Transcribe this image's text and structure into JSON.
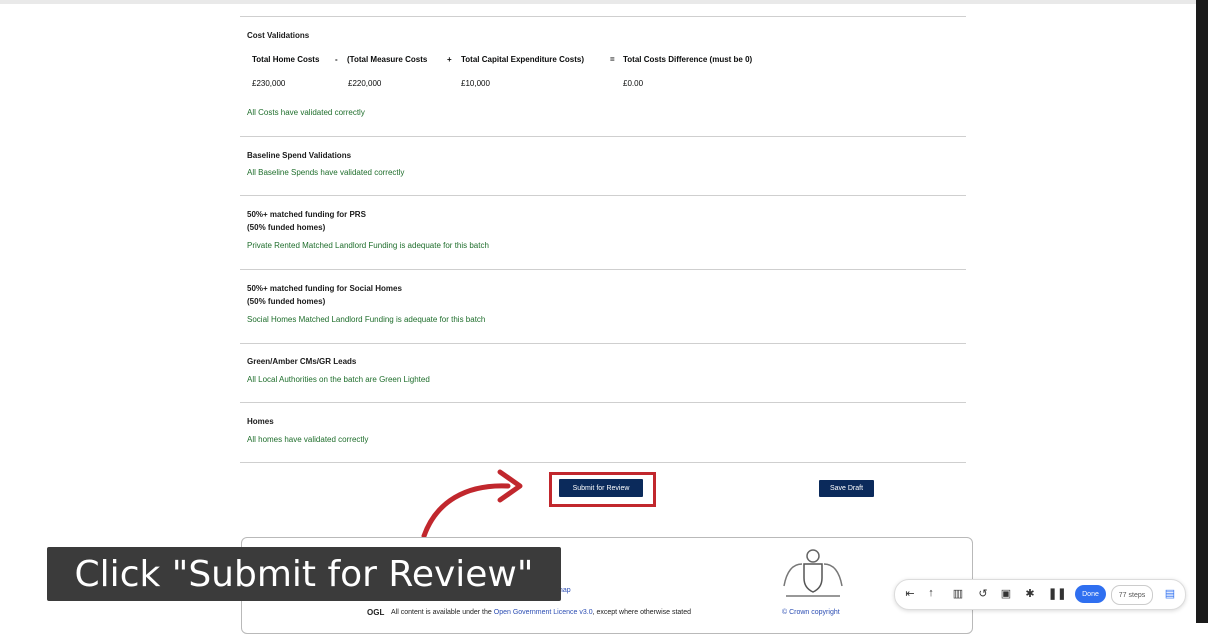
{
  "cost_validations": {
    "title": "Cost Validations",
    "headers": {
      "total_home": "Total Home Costs",
      "minus": "-",
      "measure": "(Total Measure Costs",
      "plus": "+",
      "capex": "Total Capital Expenditure Costs)",
      "equals": "=",
      "difference": "Total Costs Difference (must be 0)"
    },
    "values": {
      "total_home": "£230,000",
      "measure": "£220,000",
      "capex": "£10,000",
      "difference": "£0.00"
    },
    "status": "All Costs have validated correctly"
  },
  "baseline": {
    "title": "Baseline Spend Validations",
    "status": "All Baseline Spends have validated correctly"
  },
  "prs": {
    "title": "50%+ matched funding for PRS",
    "subtitle": "(50% funded homes)",
    "status": "Private Rented Matched Landlord Funding is adequate for this batch"
  },
  "social": {
    "title": "50%+ matched funding for Social Homes",
    "subtitle": "(50% funded homes)",
    "status": "Social Homes Matched Landlord Funding is adequate for this batch"
  },
  "green_amber": {
    "title": "Green/Amber CMs/GR Leads",
    "status": "All Local Authorities on the batch are Green Lighted"
  },
  "homes": {
    "title": "Homes",
    "status": "All homes have validated correctly"
  },
  "actions": {
    "submit_label": "Submit for Review",
    "save_label": "Save Draft"
  },
  "footer": {
    "sitemap": "Sitemap",
    "ogl_logo": "OGL",
    "licence_prefix": "All content is available under the",
    "licence_link": "Open Government Licence v3.0",
    "licence_suffix": ", except where otherwise stated",
    "copyright": "© Crown copyright"
  },
  "caption": {
    "text": "Click \"Submit for Review\""
  },
  "recorder_toolbar": {
    "done_label": "Done",
    "count_label": "77 steps"
  },
  "colors": {
    "success_green": "#1f6e2c",
    "button_navy": "#0b2a5b",
    "highlight_red": "#c1272d",
    "caption_bg": "#3b3b3b"
  }
}
